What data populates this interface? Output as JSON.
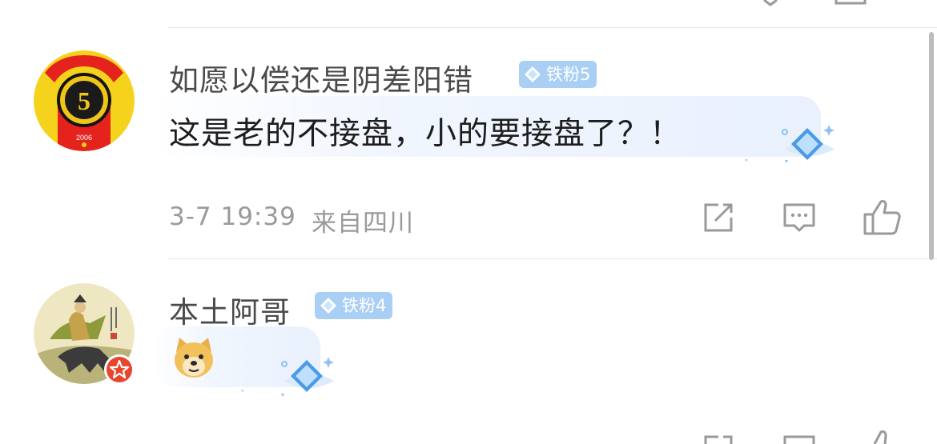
{
  "comments": [
    {
      "username": "如愿以偿还是阴差阳错",
      "badge": "铁粉5",
      "text": "这是老的不接盘，小的要接盘了？！",
      "time": "3-7 19:39",
      "location": "来自四川",
      "avatar_icon": "five-jiao-coin-avatar"
    },
    {
      "username": "本土阿哥",
      "badge": "铁粉4",
      "text": "",
      "emoji_icon": "doge-emoji",
      "avatar_icon": "painting-donkey-rider-avatar",
      "avatar_badge_icon": "red-star-badge-icon"
    }
  ],
  "colors": {
    "badge_bg": "#a9cff5",
    "meta": "#9a9a9a",
    "username": "#4a4a4a"
  }
}
